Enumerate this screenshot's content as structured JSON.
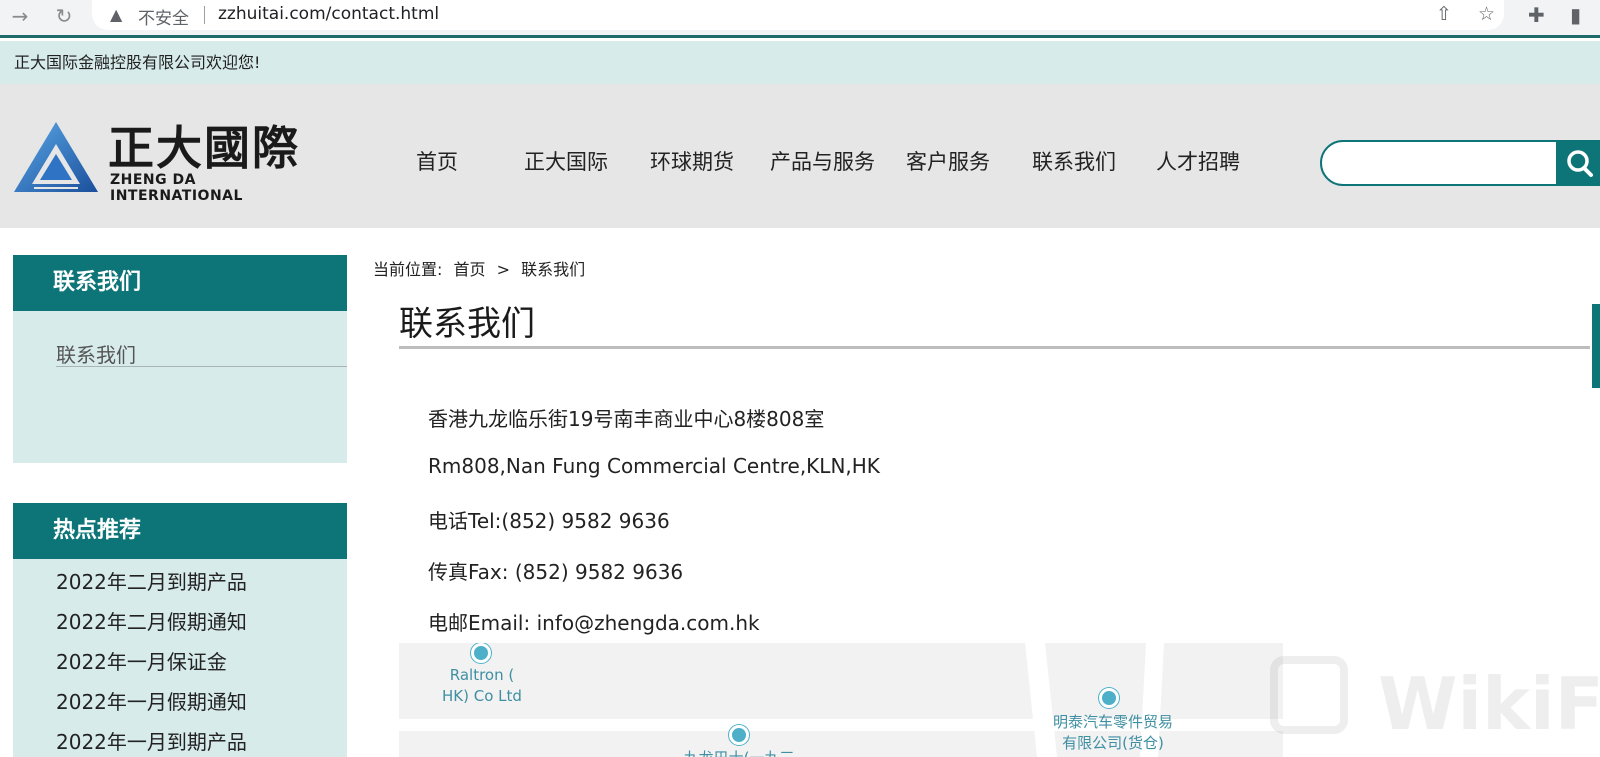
{
  "browser": {
    "insecure_label": "不安全",
    "url": "zzhuitai.com/contact.html"
  },
  "welcome": "正大国际金融控股有限公司欢迎您!",
  "logo": {
    "cn": "正大國際",
    "en": "ZHENG DA INTERNATIONAL"
  },
  "nav": {
    "items": [
      {
        "label": "首页"
      },
      {
        "label": "正大国际"
      },
      {
        "label": "环球期货"
      },
      {
        "label": "产品与服务"
      },
      {
        "label": "客户服务"
      },
      {
        "label": "联系我们"
      },
      {
        "label": "人才招聘"
      }
    ]
  },
  "search": {
    "placeholder": ""
  },
  "sidebar": {
    "contact_title": "联系我们",
    "contact_links": [
      {
        "label": "联系我们"
      }
    ],
    "hot_title": "热点推荐",
    "hot_items": [
      {
        "label": "2022年二月到期产品"
      },
      {
        "label": "2022年二月假期通知"
      },
      {
        "label": "2022年一月保证金"
      },
      {
        "label": "2022年一月假期通知"
      },
      {
        "label": "2022年一月到期产品"
      }
    ]
  },
  "breadcrumb": {
    "prefix": "当前位置:",
    "home": "首页",
    "separator": ">",
    "current": "联系我们"
  },
  "main": {
    "title": "联系我们",
    "lines": [
      "香港九龙临乐街19号南丰商业中心8楼808室",
      "Rm808,Nan Fung Commercial Centre,KLN,HK",
      "电话Tel:(852) 9582 9636",
      "传真Fax: (852) 9582 9636",
      "电邮Email: info@zhengda.com.hk"
    ]
  },
  "map": {
    "labels": [
      {
        "text": "Raltron (\nHK) Co Ltd"
      },
      {
        "text": "明泰汽车零件贸易\n有限公司(货仓)"
      },
      {
        "text": "九龙巴士(一九三"
      }
    ]
  },
  "watermark": "WikiFX",
  "colors": {
    "brand": "#0d7478",
    "panel_bg": "#d8ebeb",
    "header_bg": "#e6e6e6"
  }
}
